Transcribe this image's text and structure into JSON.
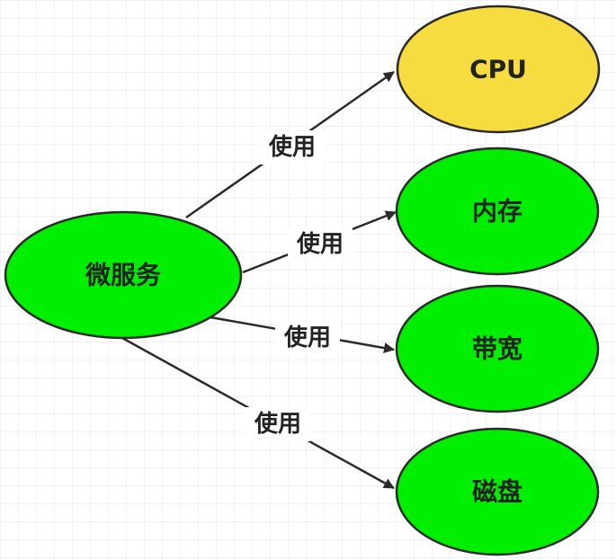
{
  "diagram": {
    "source": {
      "label": "微服务",
      "fill": "#00ee00"
    },
    "targets": [
      {
        "key": "cpu",
        "label": "CPU",
        "fill": "#f7dc3f"
      },
      {
        "key": "memory",
        "label": "内存",
        "fill": "#00ee00"
      },
      {
        "key": "bandwidth",
        "label": "带宽",
        "fill": "#00ee00"
      },
      {
        "key": "disk",
        "label": "磁盘",
        "fill": "#00ee00"
      }
    ],
    "edges": [
      {
        "from": "source",
        "to": "cpu",
        "label": "使用"
      },
      {
        "from": "source",
        "to": "memory",
        "label": "使用"
      },
      {
        "from": "source",
        "to": "bandwidth",
        "label": "使用"
      },
      {
        "from": "source",
        "to": "disk",
        "label": "使用"
      }
    ],
    "colors": {
      "stroke": "#2b2b2b",
      "grid": "#e6e6e6",
      "label_bg": "#ffffff"
    }
  }
}
